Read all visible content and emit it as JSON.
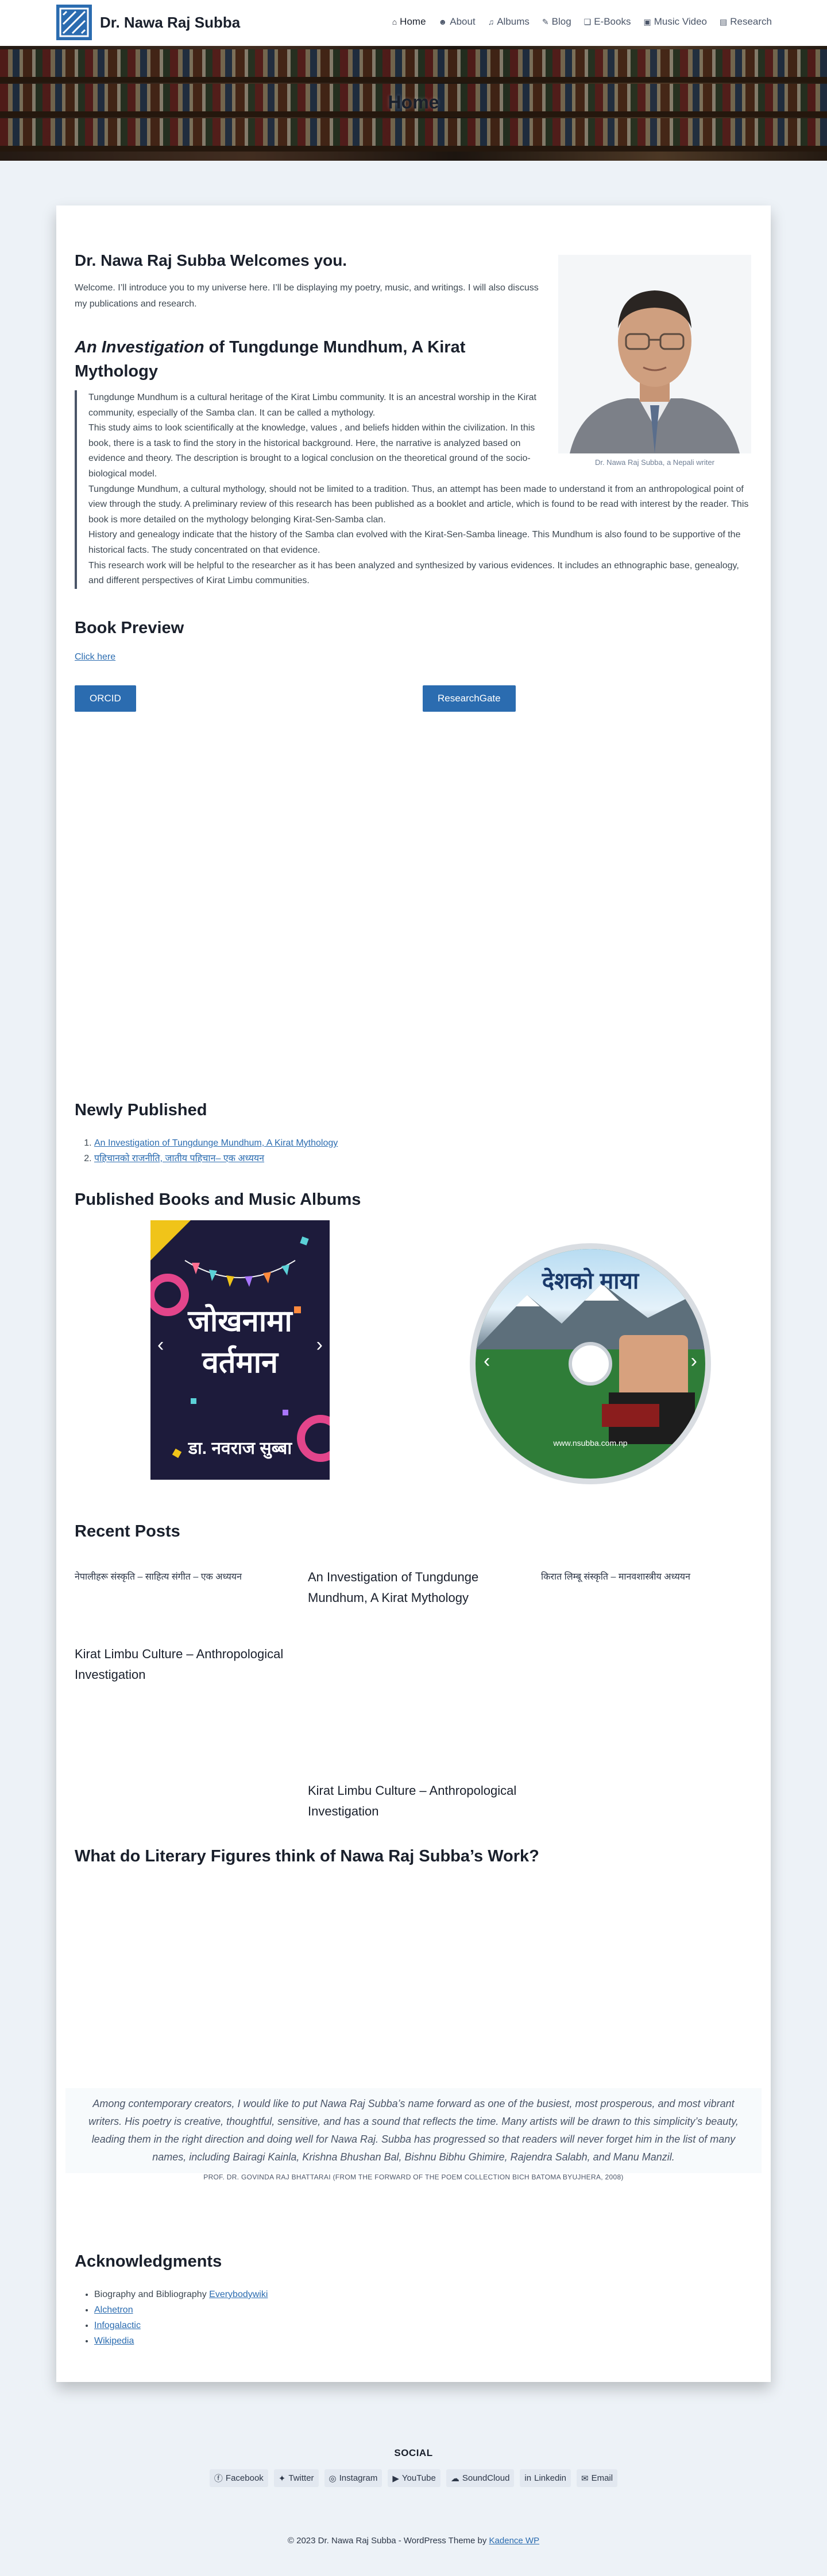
{
  "header": {
    "site_name": "Dr. Nawa Raj Subba",
    "nav": [
      {
        "label": "Home",
        "icon": "home-icon",
        "glyph": "⌂"
      },
      {
        "label": "About",
        "icon": "user-icon",
        "glyph": "☻"
      },
      {
        "label": "Albums",
        "icon": "music-icon",
        "glyph": "♫"
      },
      {
        "label": "Blog",
        "icon": "edit-icon",
        "glyph": "✎"
      },
      {
        "label": "E-Books",
        "icon": "book-icon",
        "glyph": "❑"
      },
      {
        "label": "Music Video",
        "icon": "video-icon",
        "glyph": "▣"
      },
      {
        "label": "Research",
        "icon": "document-icon",
        "glyph": "▤"
      }
    ]
  },
  "hero": {
    "title": "Home"
  },
  "intro": {
    "heading": "Dr. Nawa Raj Subba Welcomes you.",
    "text": "Welcome. I’ll introduce you to my universe here. I’ll be displaying my poetry, music, and writings. I will also discuss my publications and research.",
    "photo_caption": "Dr. Nawa Raj Subba, a Nepali writer"
  },
  "investigation": {
    "title_italic": "An Investigation",
    "title_rest": " of Tungdunge Mundhum, A Kirat Mythology",
    "paragraphs": [
      "Tungdunge Mundhum is a cultural heritage of the Kirat Limbu community. It is an ancestral worship in the Kirat community, especially of the Samba clan. It can be called a mythology.",
      "This study aims to look scientifically at the knowledge, values , and beliefs hidden within the civilization. In this book, there is a task to find the story in the historical background. Here, the narrative is analyzed based on evidence and theory. The description is brought to a logical conclusion on the theoretical ground of the socio-biological model.",
      "Tungdunge Mundhum, a cultural mythology, should not be limited to a tradition. Thus, an attempt has been made to understand it from an anthropological point of view through the study. A preliminary review of this research has been published as a booklet and article, which is found to be read with interest by the reader. This book is more detailed on the mythology belonging Kirat-Sen-Samba clan.",
      "History and genealogy indicate that the history of the Samba clan evolved with the Kirat-Sen-Samba lineage. This Mundhum is also found to be supportive of the historical facts. The study concentrated on that evidence.",
      "This research work will be helpful to the researcher as it has been analyzed and synthesized by various evidences. It includes an ethnographic base, genealogy, and different perspectives of Kirat Limbu communities."
    ]
  },
  "preview": {
    "heading": "Book Preview",
    "link": "Click here",
    "orcid": "ORCID",
    "researchgate": "ResearchGate"
  },
  "newly": {
    "heading": "Newly Published",
    "items": [
      "An Investigation of Tungdunge Mundhum, A Kirat Mythology",
      "पहिचानको राजनीति, जातीय पहिचान– एक अध्ययन"
    ]
  },
  "books": {
    "heading": "Published Books and Music Albums",
    "cover_title": "जोखनामा वर्तमान",
    "cover_author": "डा. नवराज सुब्बा",
    "cd_title": "देशको माया",
    "cd_url": "www.nsubba.com.np"
  },
  "recent": {
    "heading": "Recent Posts",
    "posts": [
      "नेपालीहरू संस्कृति – साहित्य संगीत – एक अध्ययन",
      "An Investigation of Tungdunge Mundhum, A Kirat Mythology",
      "किरात लिम्बू संस्कृति – मानवशास्त्रीय अध्ययन",
      "Kirat Limbu Culture – Anthropological Investigation",
      "Kirat Limbu Culture – Anthropological Investigation"
    ]
  },
  "figures": {
    "heading": "What do Literary Figures think of Nawa Raj Subba’s Work?",
    "quote": "Among contemporary creators, I would like to put Nawa Raj Subba’s name forward as one of the busiest, most prosperous, and most vibrant writers. His poetry is creative, thoughtful, sensitive, and has a sound that reflects the time. Many artists will be drawn to this simplicity’s beauty, leading them in the right direction and doing well for Nawa Raj. Subba has progressed so that readers will never forget him in the list of many names, including Bairagi Kainla, Krishna Bhushan Bal, Bishnu Bibhu Ghimire, Rajendra Salabh, and Manu Manzil.",
    "cite": "PROF. DR. GOVINDA RAJ BHATTARAI (FROM THE FORWARD OF THE POEM COLLECTION BICH BATOMA BYUJHERA, 2008)"
  },
  "ack": {
    "heading": "Acknowledgments",
    "first_prefix": "Biography and Bibliography ",
    "first_link": "Everybodywiki",
    "links": [
      "Alchetron",
      "Infogalactic",
      "Wikipedia"
    ]
  },
  "footer": {
    "social_title": "SOCIAL",
    "social": [
      {
        "label": "Facebook",
        "glyph": "ⓕ",
        "icon": "facebook-icon"
      },
      {
        "label": "Twitter",
        "glyph": "✦",
        "icon": "twitter-icon"
      },
      {
        "label": "Instagram",
        "glyph": "◎",
        "icon": "instagram-icon"
      },
      {
        "label": "YouTube",
        "glyph": "▶",
        "icon": "youtube-icon"
      },
      {
        "label": "SoundCloud",
        "glyph": "☁",
        "icon": "soundcloud-icon"
      },
      {
        "label": "Linkedin",
        "glyph": "in",
        "icon": "linkedin-icon"
      },
      {
        "label": "Email",
        "glyph": "✉",
        "icon": "email-icon"
      }
    ],
    "copyright_prefix": "© 2023 Dr. Nawa Raj Subba - WordPress Theme by ",
    "copyright_link": "Kadence WP"
  },
  "colors": {
    "accent": "#2b6cb0",
    "background": "#edf2f7",
    "card": "#ffffff"
  }
}
